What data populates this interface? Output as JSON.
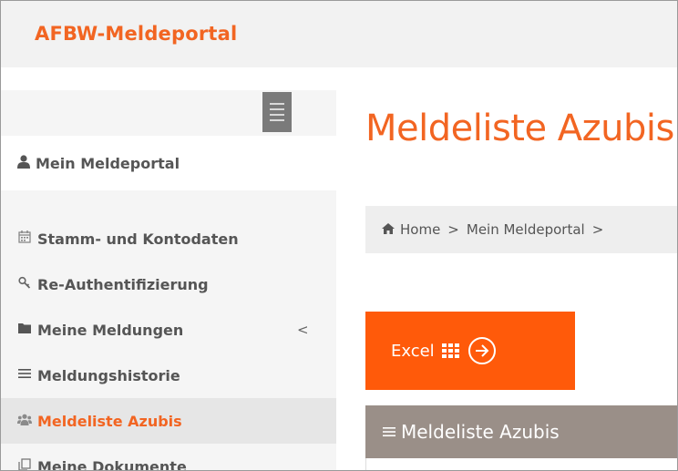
{
  "app": {
    "brand": "AFBW-Meldeportal"
  },
  "sidebar": {
    "toggle_icon": "hamburger-icon",
    "profile": {
      "icon": "user-icon",
      "label": "Mein Meldeportal"
    },
    "items": [
      {
        "icon": "calendar-icon",
        "label": "Stamm- und Kontodaten",
        "active": false
      },
      {
        "icon": "key-icon",
        "label": "Re-Authentifizierung",
        "active": false
      },
      {
        "icon": "folder-icon",
        "label": "Meine Meldungen",
        "active": false,
        "has_submenu": true,
        "chevron": "<"
      },
      {
        "icon": "list-icon",
        "label": "Meldungshistorie",
        "active": false
      },
      {
        "icon": "group-icon",
        "label": "Meldeliste Azubis",
        "active": true
      },
      {
        "icon": "documents-icon",
        "label": "Meine Dokumente",
        "active": false
      }
    ]
  },
  "main": {
    "title": "Meldeliste Azubis",
    "breadcrumb": [
      {
        "icon": "home-icon",
        "label": "Home"
      },
      {
        "label": "Mein Meldeportal"
      }
    ],
    "breadcrumb_sep": ">",
    "excel_button": {
      "label": "Excel",
      "icons": [
        "table-icon",
        "circle-arrow-right-icon"
      ]
    },
    "panel": {
      "icon": "list-icon",
      "title": "Meldeliste Azubis"
    }
  },
  "colors": {
    "accent": "#f26522",
    "button": "#ff5a0a",
    "panel_header": "#9a8f88",
    "sidebar_bg": "#f5f5f5",
    "active_bg": "#e6e6e6"
  }
}
